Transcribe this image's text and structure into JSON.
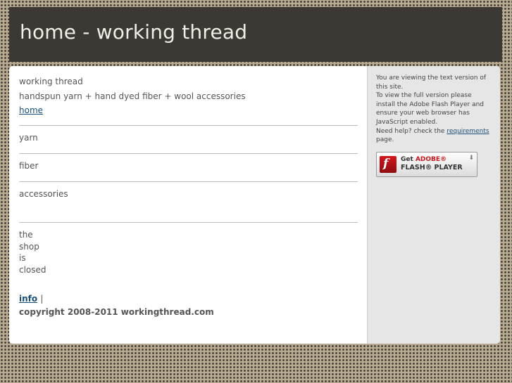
{
  "header": {
    "title": "home - working thread"
  },
  "main": {
    "site_name": "working thread",
    "tagline": "handspun yarn + hand dyed fiber + wool accessories",
    "nav": [
      {
        "label": "home",
        "link": true
      },
      {
        "label": "yarn",
        "link": false
      },
      {
        "label": "fiber",
        "link": false
      },
      {
        "label": "accessories",
        "link": false
      }
    ],
    "shop_closed_lines": [
      "the",
      "shop",
      "is",
      "closed"
    ],
    "footer": {
      "info_link": "info",
      "separator": "|",
      "copyright": "copyright 2008-2011 workingthread.com"
    }
  },
  "sidebar": {
    "line1": "You are viewing the text version of this site.",
    "line2": "To view the full version please install the Adobe Flash Player and ensure your web browser has JavaScript enabled.",
    "help_prefix": "Need help? check the",
    "help_link": "requirements",
    "help_suffix": "page.",
    "flash_button": {
      "get": "Get",
      "adobe": "ADOBE®",
      "player": "FLASH® PLAYER",
      "logo_letter": "f"
    }
  }
}
